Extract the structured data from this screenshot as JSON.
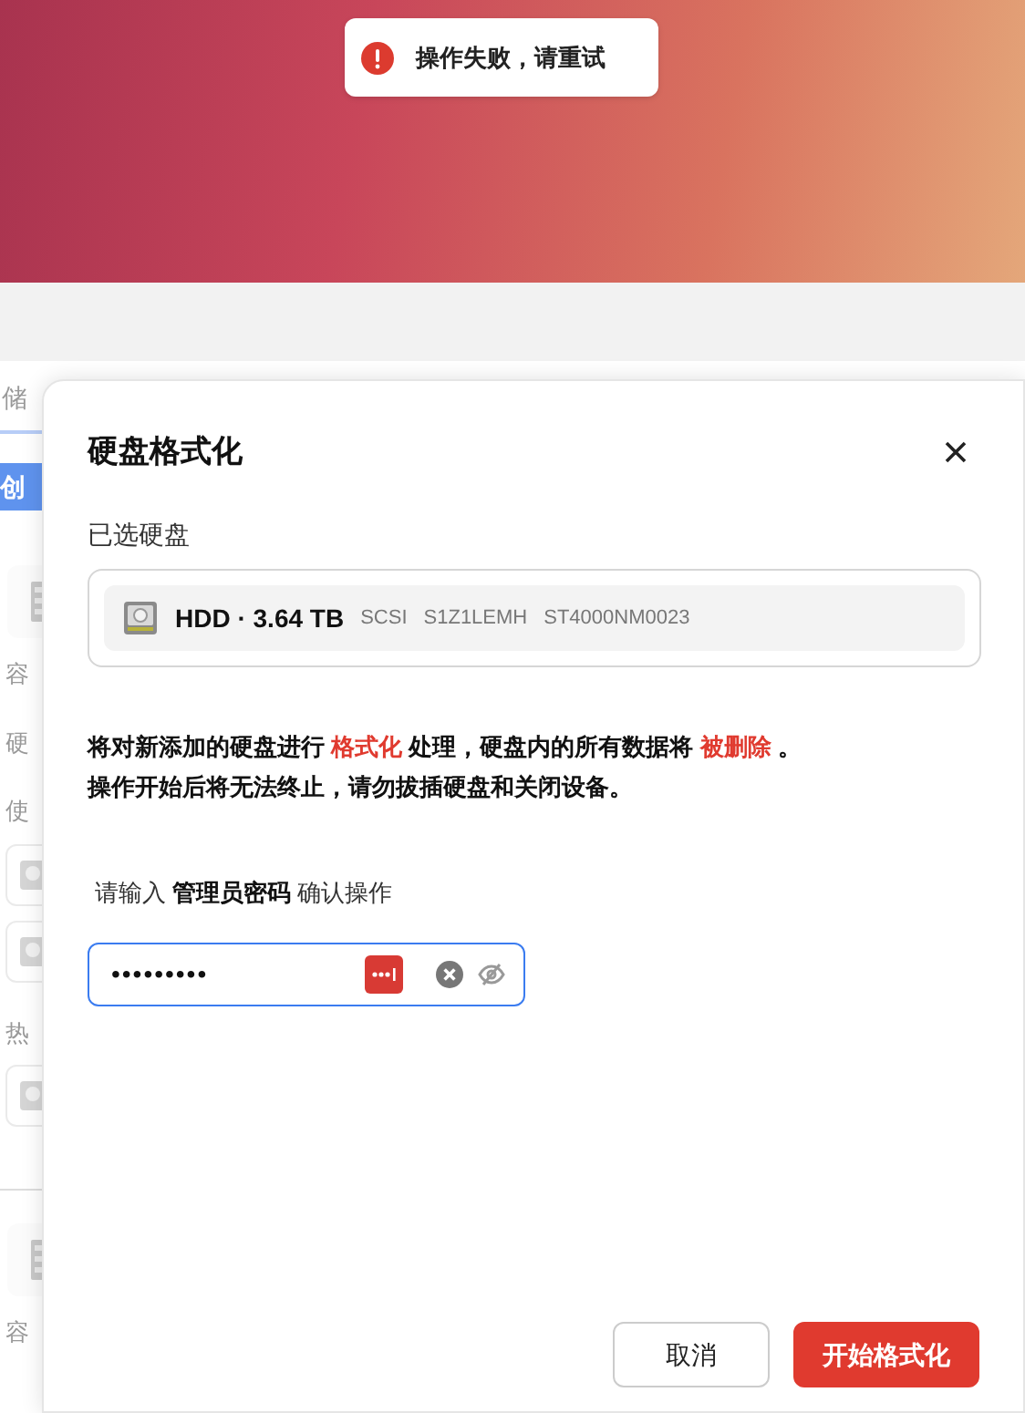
{
  "toast": {
    "kind": "error",
    "message": "操作失败，请重试"
  },
  "background": {
    "tab": "储",
    "create_button": "创",
    "sections": [
      {
        "kind": "server",
        "label": "容"
      },
      {
        "kind": "heading",
        "label": "硬"
      },
      {
        "kind": "heading",
        "label": "使"
      },
      {
        "kind": "disk"
      },
      {
        "kind": "disk"
      },
      {
        "kind": "heading",
        "label": "热"
      },
      {
        "kind": "disk"
      },
      {
        "kind": "divider"
      },
      {
        "kind": "server",
        "label": "容"
      }
    ]
  },
  "dialog": {
    "title": "硬盘格式化",
    "selected_label": "已选硬盘",
    "disk": {
      "name": "HDD · 3.64 TB",
      "details": [
        "SCSI",
        "S1Z1LEMH",
        "ST4000NM0023"
      ]
    },
    "warning": [
      "将对新添加的硬盘进行 **格式化** 处理，硬盘内的所有数据将 **被删除** 。",
      "操作开始后将无法终止，请勿拔插硬盘和关闭设备。"
    ],
    "password_prompt": "请输入 **管理员密码** 确认操作",
    "password": {
      "value": "•••••••••",
      "focused": true
    },
    "buttons": [
      {
        "label": "取消",
        "kind": "secondary"
      },
      {
        "label": "开始格式化",
        "kind": "primary"
      }
    ]
  }
}
